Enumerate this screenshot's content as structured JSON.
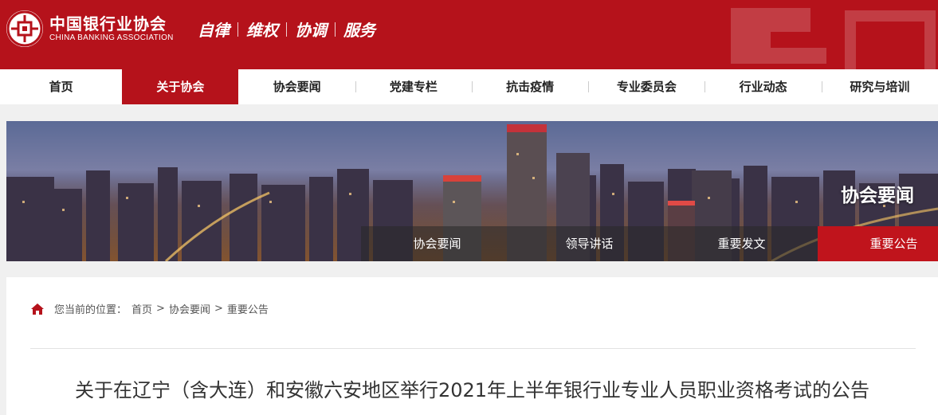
{
  "header": {
    "logo_cn": "中国银行业协会",
    "logo_en": "CHINA BANKING ASSOCIATION",
    "slogan": [
      "自律",
      "维权",
      "协调",
      "服务"
    ]
  },
  "nav": {
    "items": [
      "首页",
      "关于协会",
      "协会要闻",
      "党建专栏",
      "抗击疫情",
      "专业委员会",
      "行业动态",
      "研究与培训"
    ],
    "active": "关于协会"
  },
  "banner": {
    "title": "协会要闻",
    "subnav": [
      "协会要闻",
      "领导讲话",
      "重要发文",
      "重要公告"
    ],
    "active": "重要公告"
  },
  "breadcrumb": {
    "prefix": "您当前的位置：",
    "items": [
      "首页",
      "协会要闻",
      "重要公告"
    ],
    "separator": ">"
  },
  "article": {
    "title": "关于在辽宁（含大连）和安徽六安地区举行2021年上半年银行业专业人员职业资格考试的公告"
  },
  "colors": {
    "brand_red": "#b5121b"
  },
  "icons": {
    "home": "home-icon",
    "logo": "logo-coin-icon"
  }
}
